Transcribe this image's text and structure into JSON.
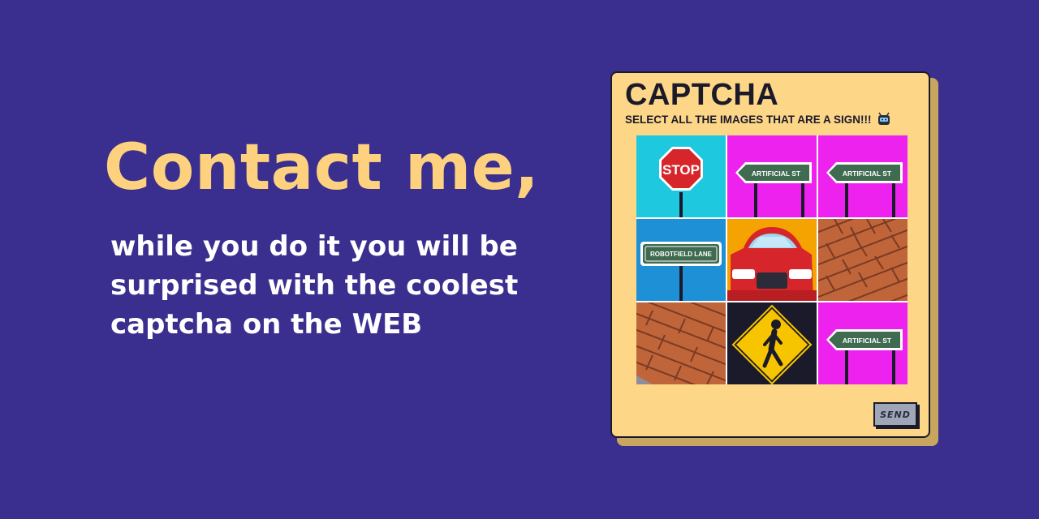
{
  "hero": {
    "headline": "Contact me,",
    "subtext": "while you do it you will be surprised with the coolest captcha on the WEB"
  },
  "captcha": {
    "title": "CAPTCHA",
    "instruction": "SELECT ALL THE IMAGES THAT ARE A SIGN!!!",
    "send_label": "SEND",
    "tiles": [
      {
        "kind": "stop-sign",
        "label": "STOP"
      },
      {
        "kind": "street-sign",
        "label": "ARTIFICIAL ST"
      },
      {
        "kind": "street-sign",
        "label": "ARTIFICIAL ST"
      },
      {
        "kind": "street-sign",
        "label": "ROBOTFIELD LANE"
      },
      {
        "kind": "car"
      },
      {
        "kind": "brick-wall"
      },
      {
        "kind": "brick-wall"
      },
      {
        "kind": "pedestrian-sign"
      },
      {
        "kind": "street-sign",
        "label": "ARTIFICIAL ST"
      }
    ]
  },
  "colors": {
    "background": "#3a2f8f",
    "headline": "#fdd17e",
    "card": "#fdd688",
    "magenta": "#ee22ee",
    "cyan": "#1ec9e0",
    "blue": "#1e90d6",
    "orange": "#f5a300",
    "brick": "#c0643a"
  }
}
